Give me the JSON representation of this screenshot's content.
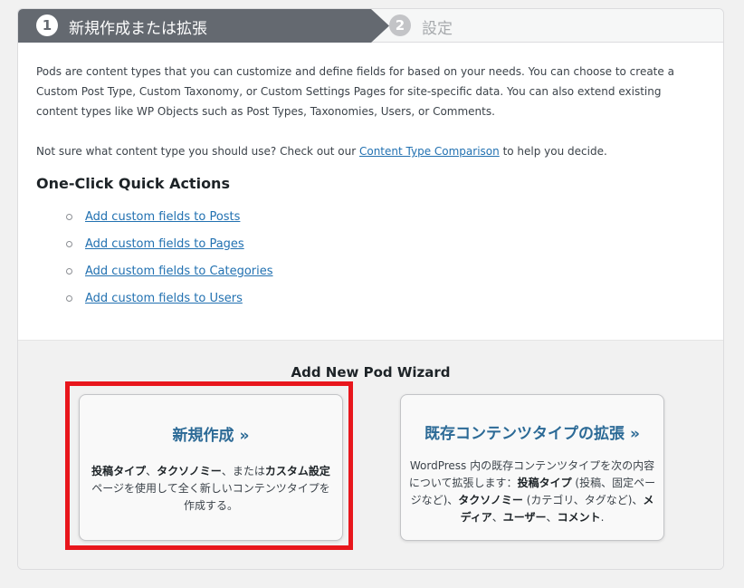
{
  "steps": [
    {
      "number": "1",
      "label": "新規作成または拡張"
    },
    {
      "number": "2",
      "label": "設定"
    }
  ],
  "intro": {
    "paragraph1": "Pods are content types that you can customize and define fields for based on your needs. You can choose to create a Custom Post Type, Custom Taxonomy, or Custom Settings Pages for site-specific data. You can also extend existing content types like WP Objects such as Post Types, Taxonomies, Users, or Comments.",
    "paragraph2_before": "Not sure what content type you should use? Check out our ",
    "paragraph2_link": "Content Type Comparison",
    "paragraph2_after": " to help you decide."
  },
  "quick_actions": {
    "title": "One-Click Quick Actions",
    "items": [
      "Add custom fields to Posts",
      "Add custom fields to Pages",
      "Add custom fields to Categories",
      "Add custom fields to Users"
    ]
  },
  "wizard": {
    "title": "Add New Pod Wizard",
    "create_new": {
      "title": "新規作成 »",
      "desc_parts": [
        "投稿タイプ",
        "、",
        "タクソノミー",
        "、または",
        "カスタム設定",
        "ページを使用して全く新しいコンテンツタイプを作成する。"
      ]
    },
    "extend_existing": {
      "title": "既存コンテンツタイプの拡張 »",
      "desc_parts": [
        "WordPress 内の既存コンテンツタイプを次の内容について拡張します：",
        "投稿タイプ",
        " (投稿、固定ページなど)、",
        "タクソノミー",
        " (カテゴリ、タグなど)、",
        "メディア",
        "、",
        "ユーザー",
        "、",
        "コメント",
        "."
      ]
    }
  },
  "colors": {
    "accent_link": "#2271b1",
    "card_title": "#2c6a96",
    "highlight": "#e8161c",
    "step_active": "#646970"
  }
}
